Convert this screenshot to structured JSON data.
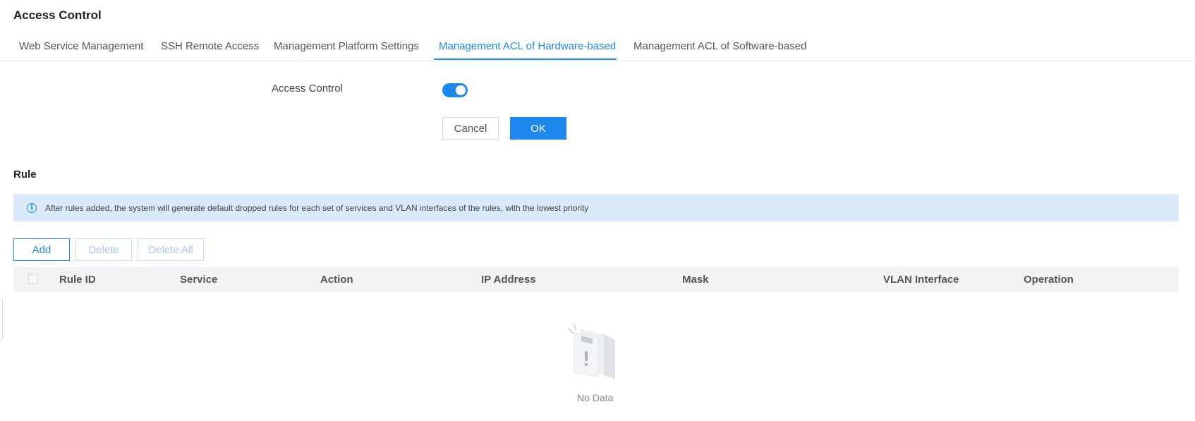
{
  "page": {
    "title": "Access Control"
  },
  "tabs": [
    {
      "label": "Web Service Management"
    },
    {
      "label": "SSH Remote Access"
    },
    {
      "label": "Management Platform Settings"
    },
    {
      "label": "Management ACL of Hardware-based"
    },
    {
      "label": "Management ACL of Software-based"
    }
  ],
  "active_tab": "Management ACL of Hardware-based",
  "form": {
    "access_control_label": "Access Control",
    "access_control_enabled": true,
    "cancel_label": "Cancel",
    "ok_label": "OK"
  },
  "rule": {
    "title": "Rule",
    "info": "After rules added, the system will generate default dropped rules for each set of services and VLAN interfaces of the rules, with the lowest priority",
    "add_label": "Add",
    "delete_label": "Delete",
    "delete_all_label": "Delete All",
    "columns": [
      "Rule ID",
      "Service",
      "Action",
      "IP Address",
      "Mask",
      "VLAN Interface",
      "Operation"
    ],
    "rows": [],
    "empty_text": "No Data"
  },
  "colors": {
    "accent": "#1e88f0",
    "info_background": "#dbe9fc",
    "header_background": "#f2f3f5"
  },
  "icons": {
    "info": "info-circle-icon",
    "empty": "empty-box-icon"
  }
}
